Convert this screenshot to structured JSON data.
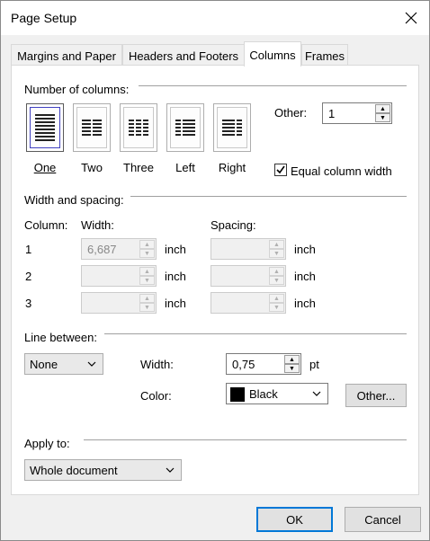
{
  "window": {
    "title": "Page Setup"
  },
  "tabs": [
    {
      "label": "Margins and Paper"
    },
    {
      "label": "Headers and Footers"
    },
    {
      "label": "Columns"
    },
    {
      "label": "Frames"
    }
  ],
  "columns_group": {
    "label": "Number of columns:",
    "options": [
      {
        "label": "One",
        "key": "O"
      },
      {
        "label": "Two",
        "key": "w"
      },
      {
        "label": "Three",
        "key": "T"
      },
      {
        "label": "Left",
        "key": "L"
      },
      {
        "label": "Right",
        "key": "R"
      }
    ],
    "other_label": "Other:",
    "other_value": "1",
    "equal_width_label": "Equal column width",
    "equal_width_checked": true
  },
  "width_spacing": {
    "label": "Width and spacing:",
    "column_header": "Column:",
    "width_header": "Width:",
    "spacing_header": "Spacing:",
    "rows": [
      {
        "num": "1",
        "width": "6,687",
        "width_unit": "inch",
        "spacing": "",
        "spacing_unit": "inch"
      },
      {
        "num": "2",
        "width": "",
        "width_unit": "inch",
        "spacing": "",
        "spacing_unit": "inch"
      },
      {
        "num": "3",
        "width": "",
        "width_unit": "inch",
        "spacing": "",
        "spacing_unit": "inch"
      }
    ]
  },
  "line_between": {
    "label": "Line between:",
    "style": "None",
    "width_label": "Width:",
    "width_value": "0,75",
    "width_unit": "pt",
    "color_label": "Color:",
    "color_value": "Black",
    "color_swatch": "#000000",
    "other_button": "Other..."
  },
  "apply_to": {
    "label": "Apply to:",
    "value": "Whole document"
  },
  "footer": {
    "ok": "OK",
    "cancel": "Cancel"
  }
}
